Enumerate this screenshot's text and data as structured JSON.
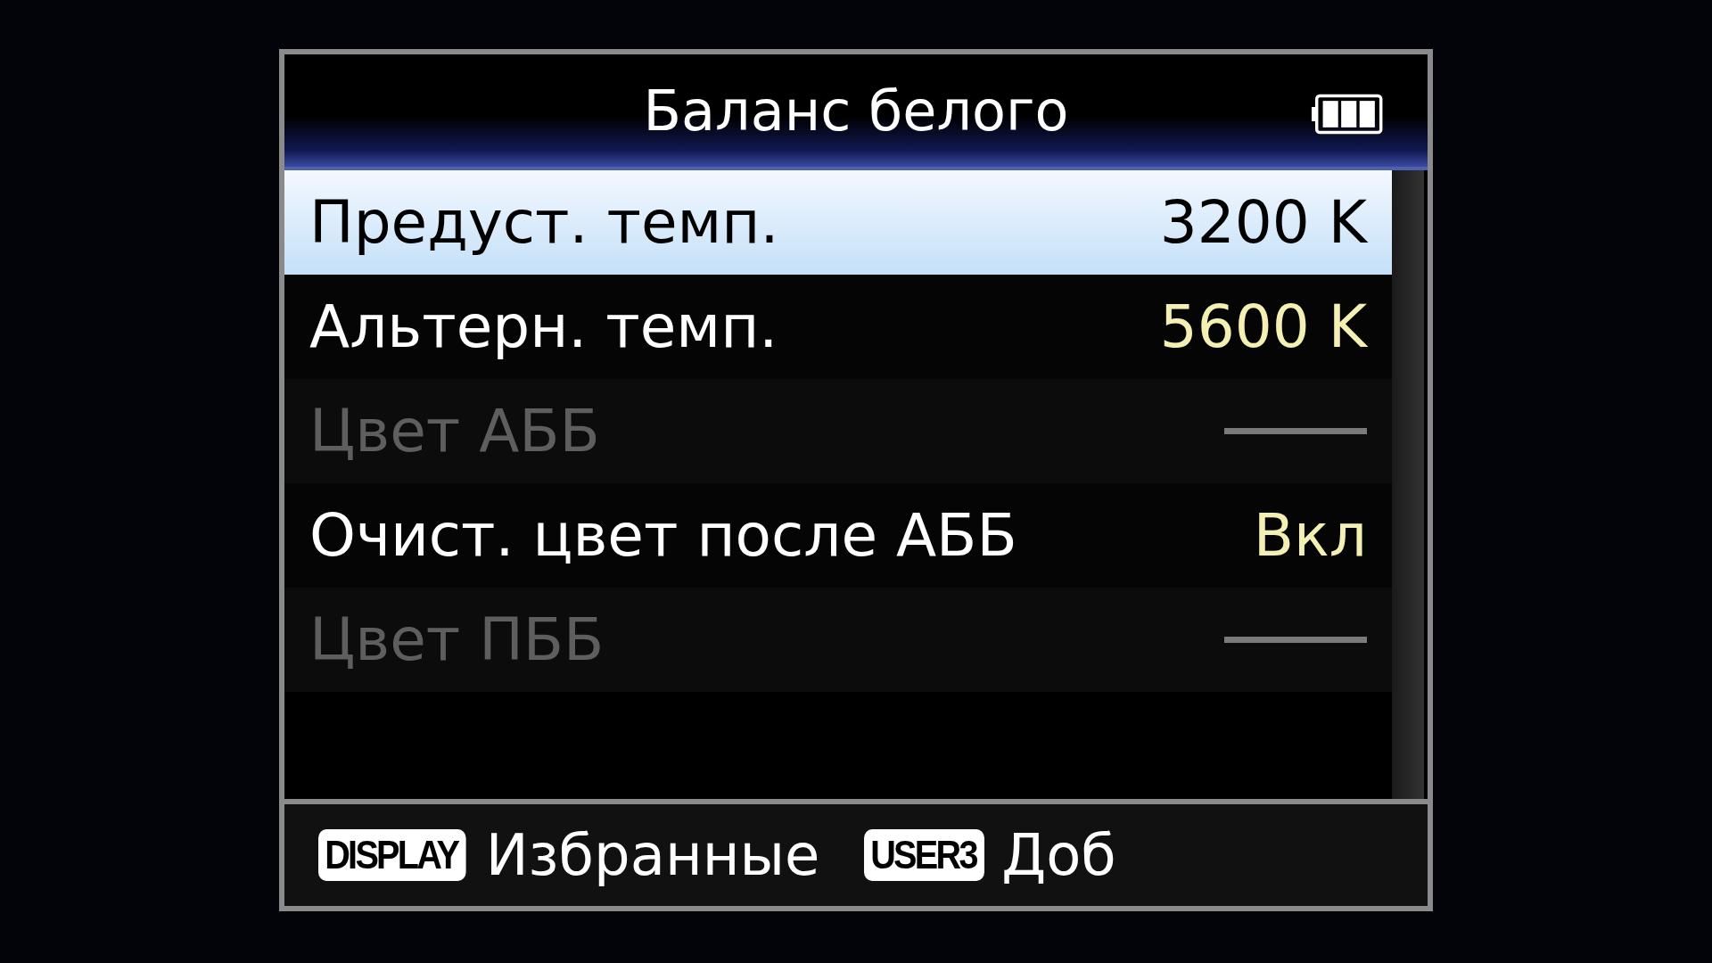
{
  "title": "Баланс белого",
  "items": [
    {
      "label": "Предуст. темп.",
      "kind": "value",
      "value": "3200 K",
      "selected": true,
      "disabled": false
    },
    {
      "label": "Альтерн. темп.",
      "kind": "value",
      "value": "5600 K",
      "selected": false,
      "disabled": false
    },
    {
      "label": "Цвет АББ",
      "kind": "dash",
      "selected": false,
      "disabled": true
    },
    {
      "label": "Очист. цвет после АББ",
      "kind": "value",
      "value": "Вкл",
      "selected": false,
      "disabled": false
    },
    {
      "label": "Цвет ПББ",
      "kind": "dash",
      "selected": false,
      "disabled": true
    }
  ],
  "footer": [
    {
      "key": "DISPLAY",
      "label": "Избранные"
    },
    {
      "key": "USER3",
      "label": "Доб"
    }
  ]
}
